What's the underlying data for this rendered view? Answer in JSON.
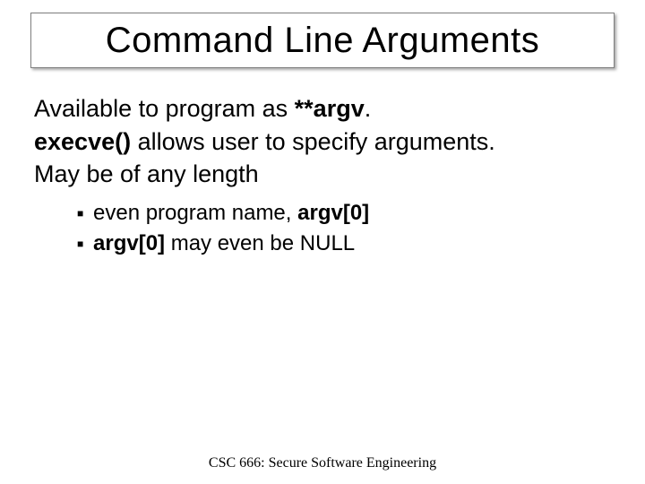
{
  "title": "Command Line Arguments",
  "body": {
    "line1_pre": "Available to program as ",
    "line1_bold": "**argv",
    "line1_post": ".",
    "line2_bold": "execve()",
    "line2_post": " allows user to specify arguments.",
    "line3": "May be of any length"
  },
  "sublist": {
    "item1_pre": "even program name, ",
    "item1_bold": "argv[0]",
    "item2_bold": "argv[0]",
    "item2_post": " may even be NULL"
  },
  "footer": "CSC 666: Secure Software Engineering"
}
